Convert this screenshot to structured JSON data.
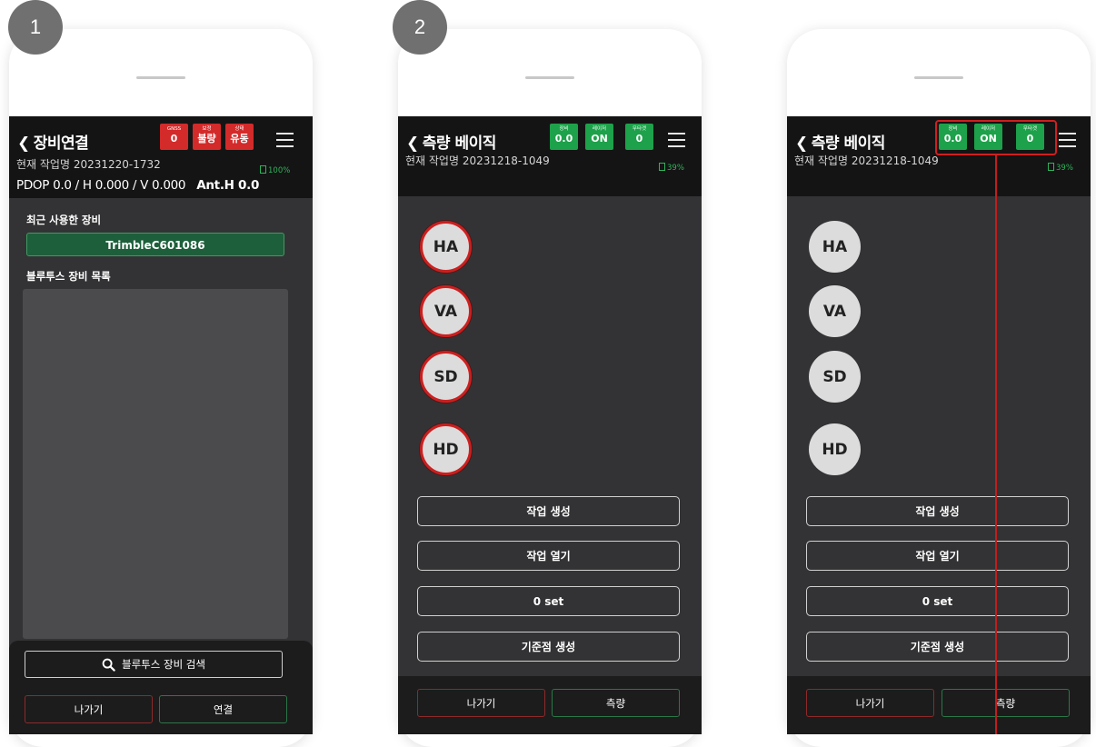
{
  "steps": {
    "first": "1",
    "second": "2"
  },
  "common": {
    "menu_icon": "hamburger-menu-icon",
    "back_icon": "chevron-left-icon"
  },
  "phone1": {
    "title": "장비연결",
    "work_name": "현재 작업명 20231220-1732",
    "battery": "100%",
    "badges": [
      {
        "label": "GNSS",
        "value": "0"
      },
      {
        "label": "보정",
        "value": "불량"
      },
      {
        "label": "상태",
        "value": "유동"
      }
    ],
    "pdop": "PDOP 0.0 / H 0.000 / V 0.000",
    "ant": "Ant.H 0.0",
    "recent_title": "최근 사용한 장비",
    "recent_device": "TrimbleC601086",
    "bt_list_title": "블루투스 장비 목록",
    "search_label": "블루투스 장비 검색",
    "exit_label": "나가기",
    "connect_label": "연결",
    "colors": {
      "badge": "#d32a2a",
      "recent_bg": "#1d5f3a"
    }
  },
  "phone2": {
    "title": "측량 베이직",
    "work_name": "현재 작업명 20231218-1049",
    "battery": "39%",
    "badges": [
      {
        "label": "장비",
        "value": "0.0"
      },
      {
        "label": "레이저",
        "value": "ON"
      },
      {
        "label": "무타겟",
        "value": "0"
      }
    ],
    "measurements": [
      "HA",
      "VA",
      "SD",
      "HD"
    ],
    "actions": [
      "작업 생성",
      "작업 열기",
      "0 set",
      "기준점 생성"
    ],
    "exit_label": "나가기",
    "measure_label": "측량",
    "colors": {
      "badge": "#1da14a",
      "highlight": "#cc1f1f"
    }
  },
  "phone3": {
    "title": "측량 베이직",
    "work_name": "현재 작업명 20231218-1049",
    "battery": "39%",
    "badges": [
      {
        "label": "장비",
        "value": "0.0"
      },
      {
        "label": "레이저",
        "value": "ON"
      },
      {
        "label": "무타겟",
        "value": "0"
      }
    ],
    "measurements": [
      "HA",
      "VA",
      "SD",
      "HD"
    ],
    "actions": [
      "작업 생성",
      "작업 열기",
      "0 set",
      "기준점 생성"
    ],
    "exit_label": "나가기",
    "measure_label": "측량"
  }
}
